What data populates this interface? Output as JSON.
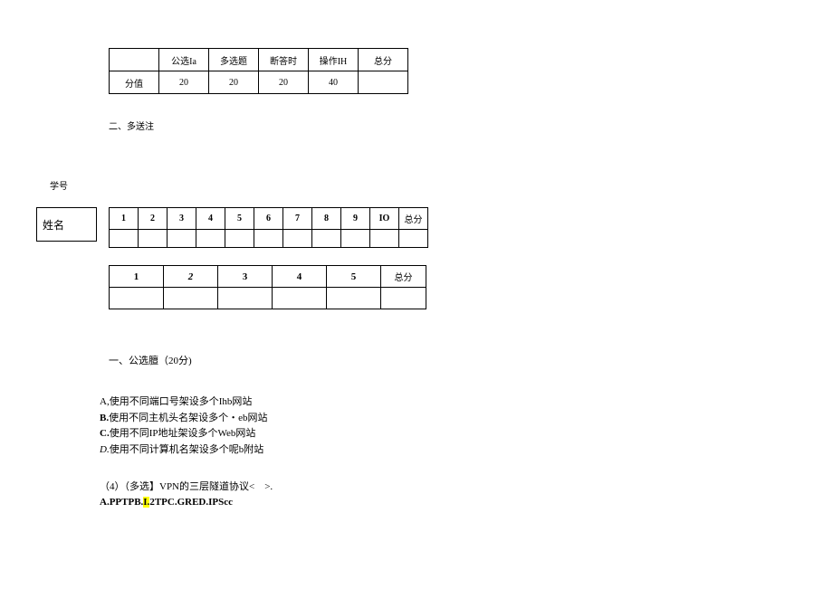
{
  "scoreTable": {
    "headers": [
      "",
      "公选Ia",
      "多选题",
      "断答时",
      "操作IH",
      "总分"
    ],
    "rowLabel": "分值",
    "values": [
      "20",
      "20",
      "20",
      "40",
      ""
    ]
  },
  "sections": {
    "multiSelect": "二、多送注"
  },
  "studentId": "学号",
  "nameLabel": "姓名",
  "answerTable1": {
    "headers": [
      "1",
      "2",
      "3",
      "4",
      "5",
      "6",
      "7",
      "8",
      "9",
      "IO",
      "总分"
    ]
  },
  "answerTable2": {
    "headers": [
      "1",
      "2",
      "3",
      "4",
      "5",
      "总分"
    ]
  },
  "heading1": "一、公选膻（20分)",
  "options": {
    "a": "A,使用不同端口号架设多个Ihb网站",
    "b_pre": "B.",
    "b_rest": "使用不同主机头名架设多个・eb网站",
    "c_pre": "C.",
    "c_rest": "使用不同IP地址架设多个Web网站",
    "d_pre": "D.",
    "d_rest": "使用不同计算机名架设多个呢b附站"
  },
  "q4": {
    "line1": "（4）（多选】VPN的三层隧道协议<　>.",
    "line2_a": "A.PPTPB.",
    "line2_hl": "I.",
    "line2_b": "2TPC.GRED.IPScc"
  }
}
